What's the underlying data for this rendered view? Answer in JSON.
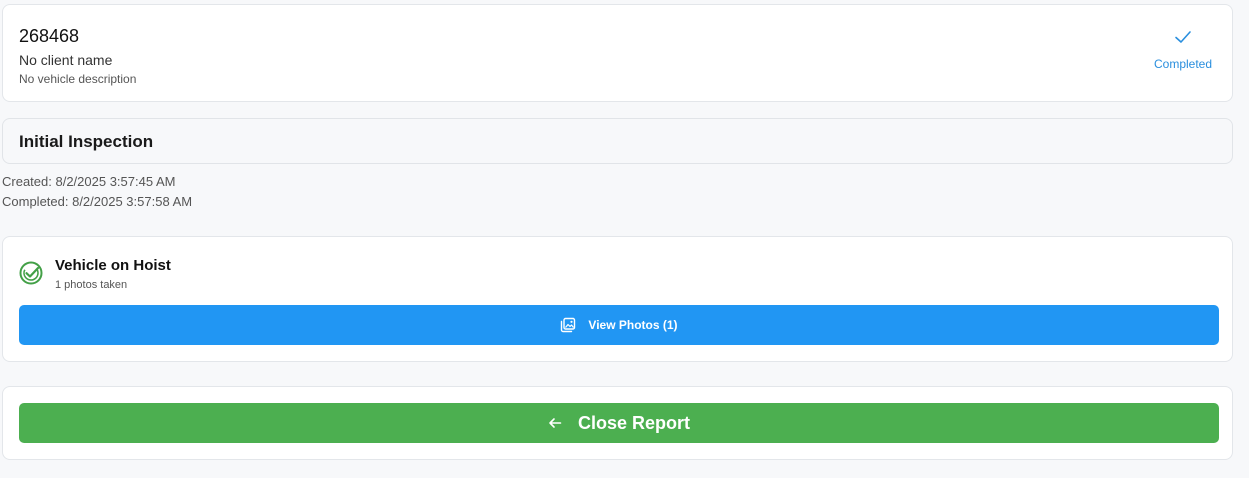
{
  "header": {
    "job_number": "268468",
    "client_name": "No client name",
    "vehicle_description": "No vehicle description",
    "status_label": "Completed",
    "status_icon": "checkmark-icon"
  },
  "inspection": {
    "title": "Initial Inspection",
    "created": "Created: 8/2/2025 3:57:45 AM",
    "completed": "Completed: 8/2/2025 3:57:58 AM"
  },
  "checklist": {
    "items": [
      {
        "title": "Vehicle on Hoist",
        "subtitle": "1 photos taken",
        "status_icon": "check-circle-icon",
        "button_label": "View Photos (1)",
        "button_icon": "photo-library-icon"
      }
    ]
  },
  "footer": {
    "close_label": "Close Report",
    "close_icon": "arrow-left-icon"
  },
  "colors": {
    "accent_blue": "#2196f3",
    "status_blue": "#2a8fde",
    "success_green": "#4caf50",
    "check_green": "#43a047"
  }
}
